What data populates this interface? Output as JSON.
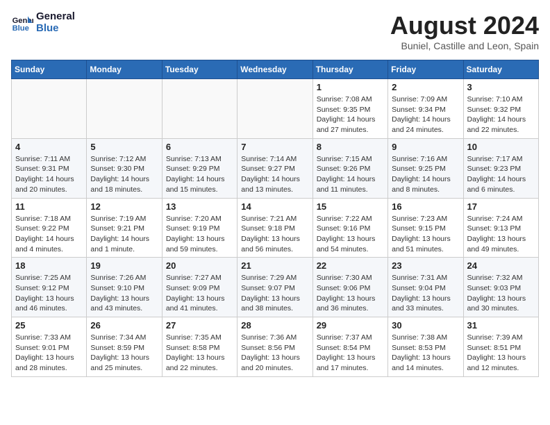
{
  "header": {
    "logo_line1": "General",
    "logo_line2": "Blue",
    "month_year": "August 2024",
    "location": "Buniel, Castille and Leon, Spain"
  },
  "days_of_week": [
    "Sunday",
    "Monday",
    "Tuesday",
    "Wednesday",
    "Thursday",
    "Friday",
    "Saturday"
  ],
  "weeks": [
    [
      {
        "day": "",
        "info": ""
      },
      {
        "day": "",
        "info": ""
      },
      {
        "day": "",
        "info": ""
      },
      {
        "day": "",
        "info": ""
      },
      {
        "day": "1",
        "info": "Sunrise: 7:08 AM\nSunset: 9:35 PM\nDaylight: 14 hours\nand 27 minutes."
      },
      {
        "day": "2",
        "info": "Sunrise: 7:09 AM\nSunset: 9:34 PM\nDaylight: 14 hours\nand 24 minutes."
      },
      {
        "day": "3",
        "info": "Sunrise: 7:10 AM\nSunset: 9:32 PM\nDaylight: 14 hours\nand 22 minutes."
      }
    ],
    [
      {
        "day": "4",
        "info": "Sunrise: 7:11 AM\nSunset: 9:31 PM\nDaylight: 14 hours\nand 20 minutes."
      },
      {
        "day": "5",
        "info": "Sunrise: 7:12 AM\nSunset: 9:30 PM\nDaylight: 14 hours\nand 18 minutes."
      },
      {
        "day": "6",
        "info": "Sunrise: 7:13 AM\nSunset: 9:29 PM\nDaylight: 14 hours\nand 15 minutes."
      },
      {
        "day": "7",
        "info": "Sunrise: 7:14 AM\nSunset: 9:27 PM\nDaylight: 14 hours\nand 13 minutes."
      },
      {
        "day": "8",
        "info": "Sunrise: 7:15 AM\nSunset: 9:26 PM\nDaylight: 14 hours\nand 11 minutes."
      },
      {
        "day": "9",
        "info": "Sunrise: 7:16 AM\nSunset: 9:25 PM\nDaylight: 14 hours\nand 8 minutes."
      },
      {
        "day": "10",
        "info": "Sunrise: 7:17 AM\nSunset: 9:23 PM\nDaylight: 14 hours\nand 6 minutes."
      }
    ],
    [
      {
        "day": "11",
        "info": "Sunrise: 7:18 AM\nSunset: 9:22 PM\nDaylight: 14 hours\nand 4 minutes."
      },
      {
        "day": "12",
        "info": "Sunrise: 7:19 AM\nSunset: 9:21 PM\nDaylight: 14 hours\nand 1 minute."
      },
      {
        "day": "13",
        "info": "Sunrise: 7:20 AM\nSunset: 9:19 PM\nDaylight: 13 hours\nand 59 minutes."
      },
      {
        "day": "14",
        "info": "Sunrise: 7:21 AM\nSunset: 9:18 PM\nDaylight: 13 hours\nand 56 minutes."
      },
      {
        "day": "15",
        "info": "Sunrise: 7:22 AM\nSunset: 9:16 PM\nDaylight: 13 hours\nand 54 minutes."
      },
      {
        "day": "16",
        "info": "Sunrise: 7:23 AM\nSunset: 9:15 PM\nDaylight: 13 hours\nand 51 minutes."
      },
      {
        "day": "17",
        "info": "Sunrise: 7:24 AM\nSunset: 9:13 PM\nDaylight: 13 hours\nand 49 minutes."
      }
    ],
    [
      {
        "day": "18",
        "info": "Sunrise: 7:25 AM\nSunset: 9:12 PM\nDaylight: 13 hours\nand 46 minutes."
      },
      {
        "day": "19",
        "info": "Sunrise: 7:26 AM\nSunset: 9:10 PM\nDaylight: 13 hours\nand 43 minutes."
      },
      {
        "day": "20",
        "info": "Sunrise: 7:27 AM\nSunset: 9:09 PM\nDaylight: 13 hours\nand 41 minutes."
      },
      {
        "day": "21",
        "info": "Sunrise: 7:29 AM\nSunset: 9:07 PM\nDaylight: 13 hours\nand 38 minutes."
      },
      {
        "day": "22",
        "info": "Sunrise: 7:30 AM\nSunset: 9:06 PM\nDaylight: 13 hours\nand 36 minutes."
      },
      {
        "day": "23",
        "info": "Sunrise: 7:31 AM\nSunset: 9:04 PM\nDaylight: 13 hours\nand 33 minutes."
      },
      {
        "day": "24",
        "info": "Sunrise: 7:32 AM\nSunset: 9:03 PM\nDaylight: 13 hours\nand 30 minutes."
      }
    ],
    [
      {
        "day": "25",
        "info": "Sunrise: 7:33 AM\nSunset: 9:01 PM\nDaylight: 13 hours\nand 28 minutes."
      },
      {
        "day": "26",
        "info": "Sunrise: 7:34 AM\nSunset: 8:59 PM\nDaylight: 13 hours\nand 25 minutes."
      },
      {
        "day": "27",
        "info": "Sunrise: 7:35 AM\nSunset: 8:58 PM\nDaylight: 13 hours\nand 22 minutes."
      },
      {
        "day": "28",
        "info": "Sunrise: 7:36 AM\nSunset: 8:56 PM\nDaylight: 13 hours\nand 20 minutes."
      },
      {
        "day": "29",
        "info": "Sunrise: 7:37 AM\nSunset: 8:54 PM\nDaylight: 13 hours\nand 17 minutes."
      },
      {
        "day": "30",
        "info": "Sunrise: 7:38 AM\nSunset: 8:53 PM\nDaylight: 13 hours\nand 14 minutes."
      },
      {
        "day": "31",
        "info": "Sunrise: 7:39 AM\nSunset: 8:51 PM\nDaylight: 13 hours\nand 12 minutes."
      }
    ]
  ]
}
